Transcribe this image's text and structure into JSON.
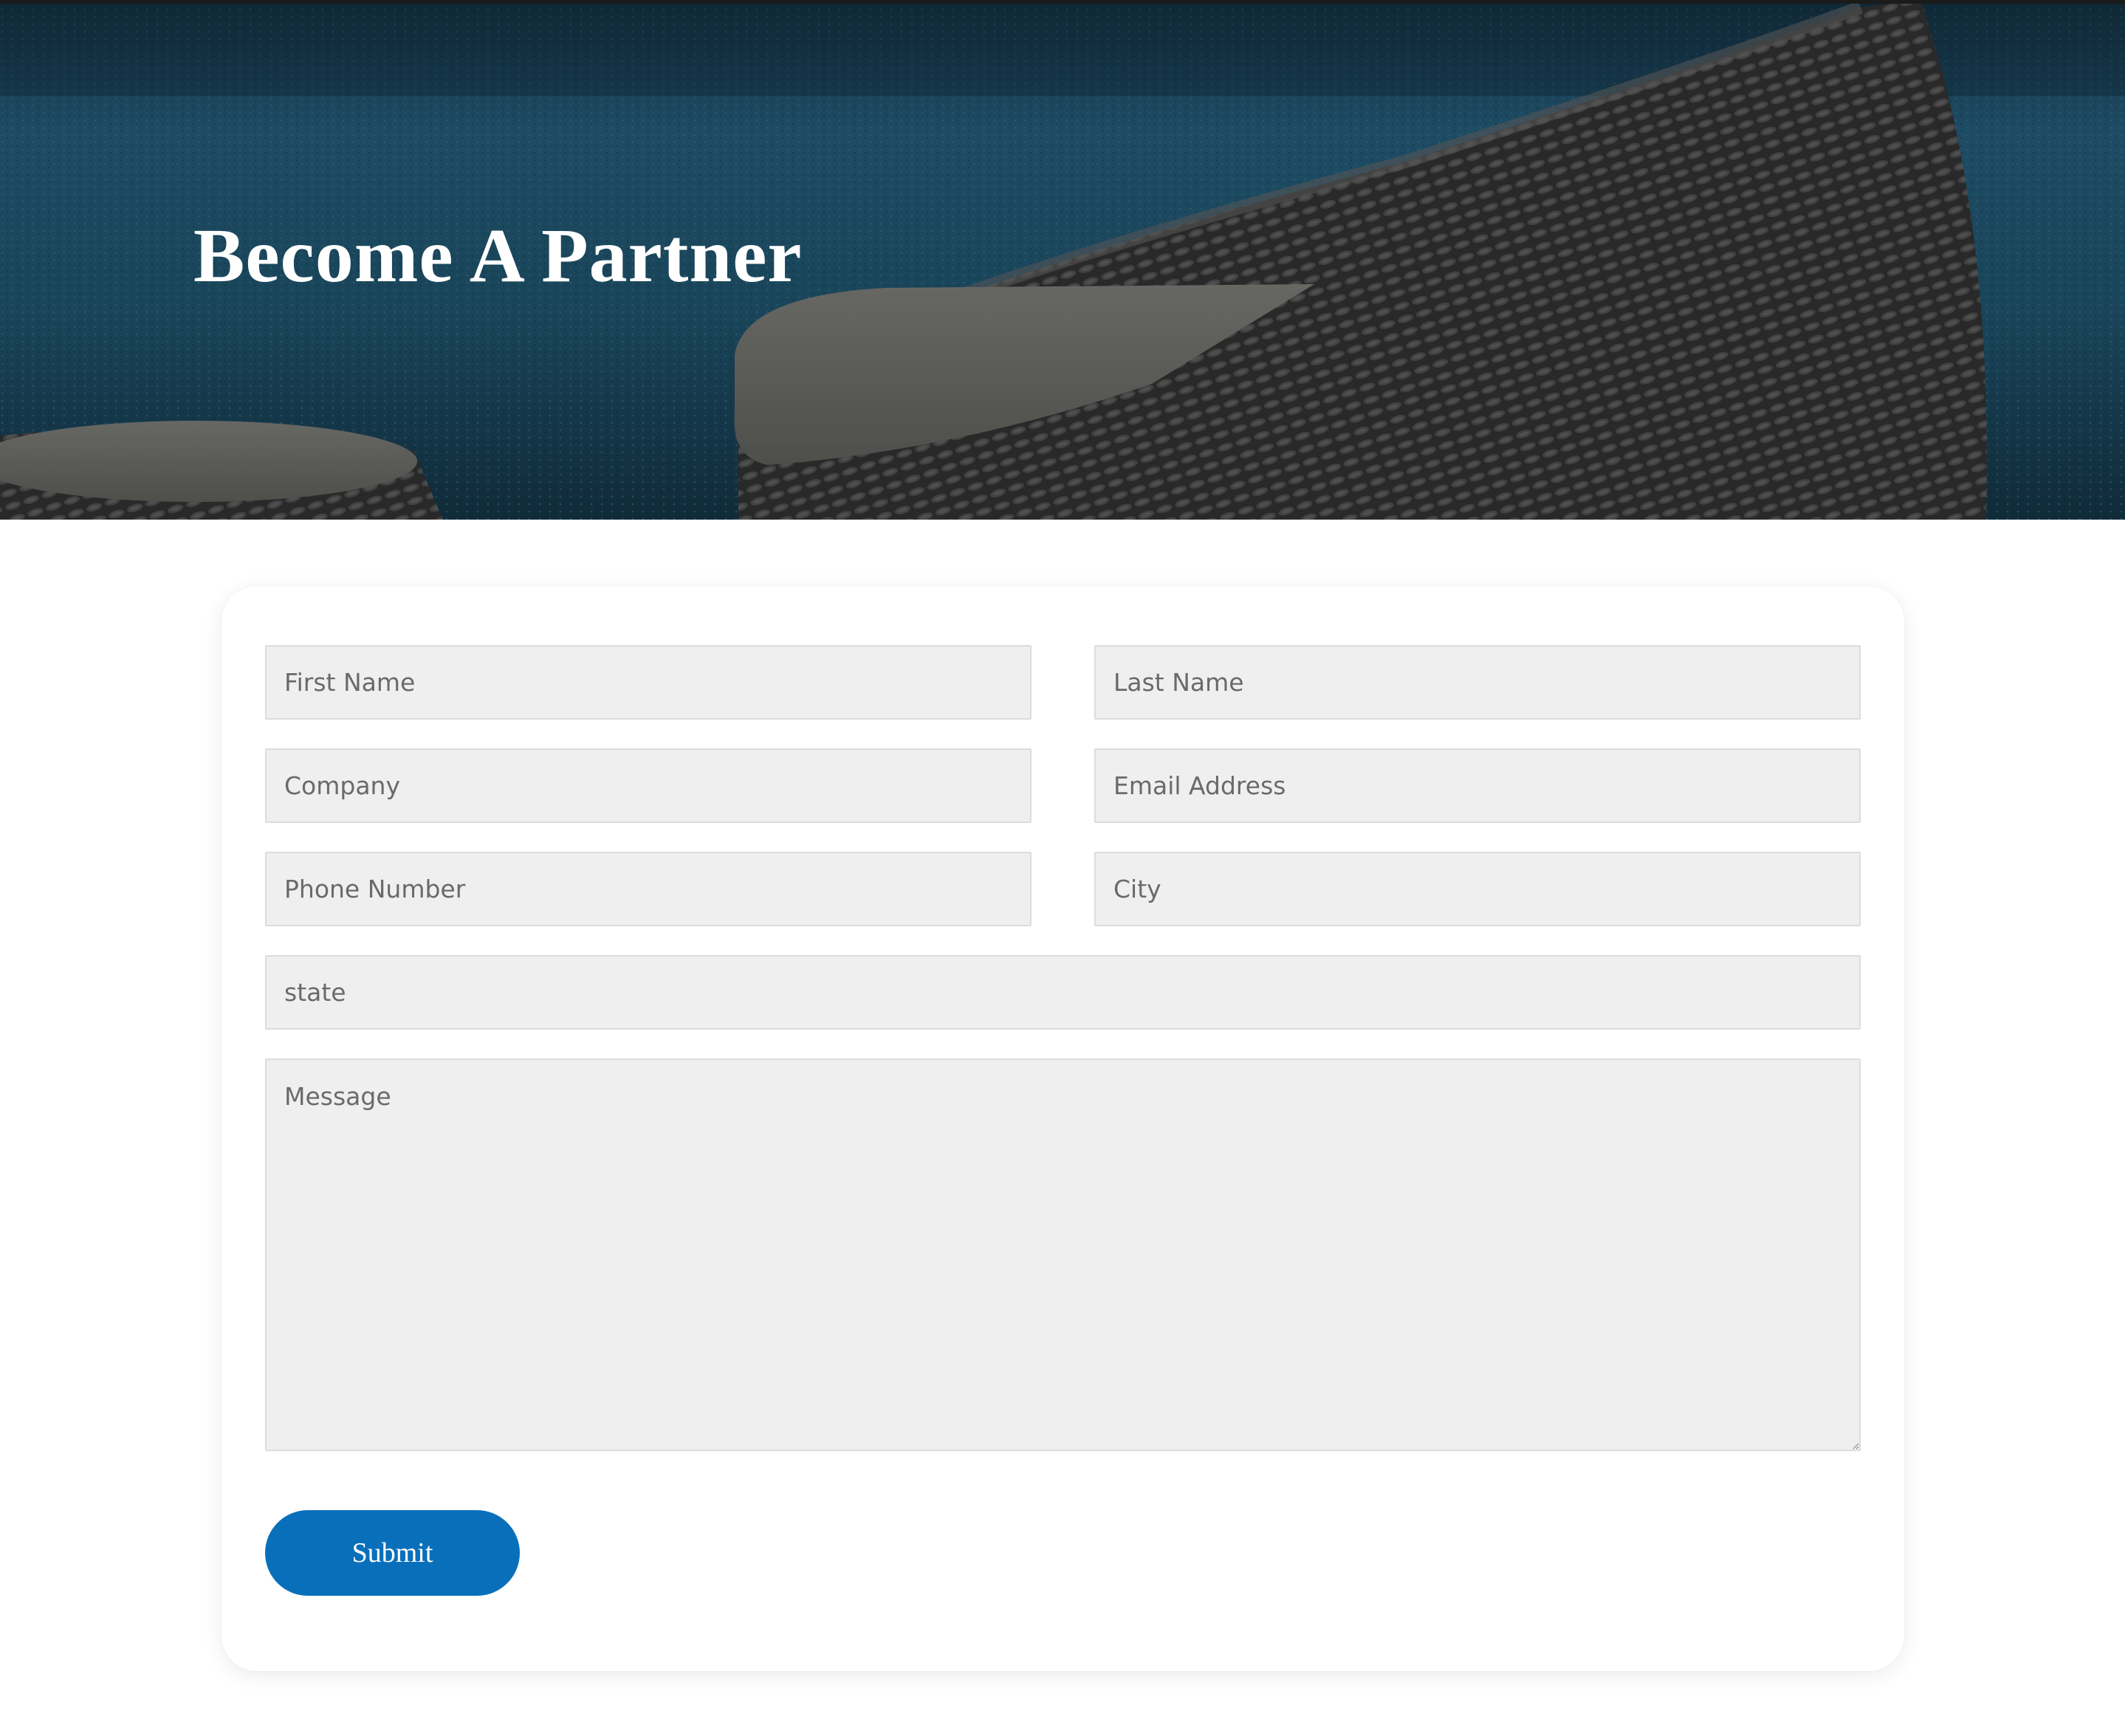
{
  "hero": {
    "title": "Become A Partner"
  },
  "form": {
    "first_name": {
      "placeholder": "First Name",
      "value": ""
    },
    "last_name": {
      "placeholder": "Last Name",
      "value": ""
    },
    "company": {
      "placeholder": "Company",
      "value": ""
    },
    "email": {
      "placeholder": "Email Address",
      "value": ""
    },
    "phone": {
      "placeholder": "Phone Number",
      "value": ""
    },
    "city": {
      "placeholder": "City",
      "value": ""
    },
    "state": {
      "placeholder": "state",
      "value": ""
    },
    "message": {
      "placeholder": "Message",
      "value": ""
    },
    "submit_label": "Submit"
  },
  "colors": {
    "accent": "#0a6fbb",
    "field_background": "#efefef",
    "hero_overlay": "#1f4a63"
  }
}
